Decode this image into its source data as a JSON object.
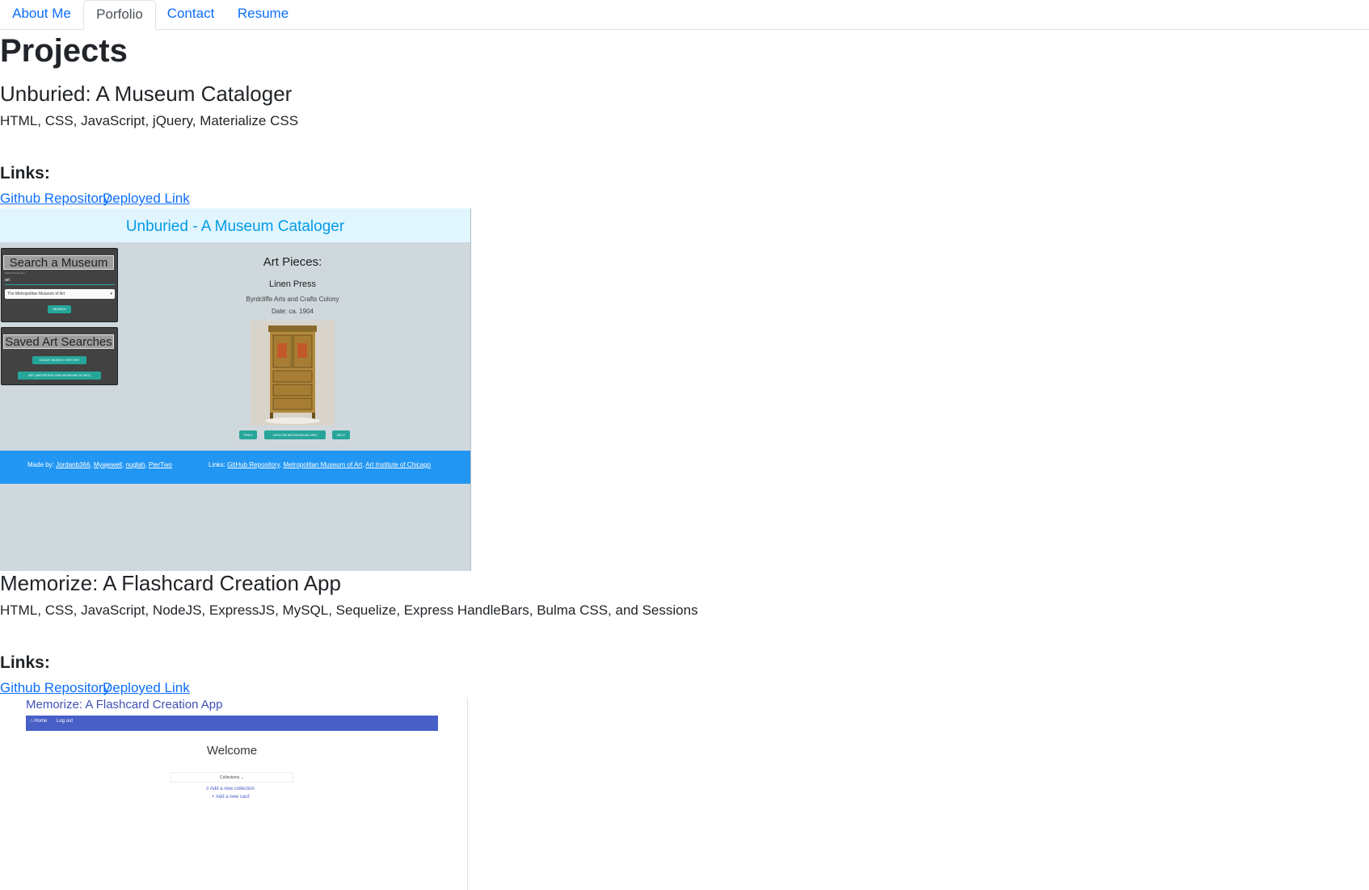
{
  "nav": {
    "tabs": [
      {
        "label": "About Me",
        "active": false
      },
      {
        "label": "Porfolio",
        "active": true
      },
      {
        "label": "Contact",
        "active": false
      },
      {
        "label": "Resume",
        "active": false
      }
    ]
  },
  "page_title": "Projects",
  "projects": [
    {
      "title": "Unburied: A Museum Cataloger",
      "tech": "HTML, CSS, JavaScript, jQuery, Materialize CSS",
      "links_heading": "Links:",
      "github_label": "Github Repository",
      "deployed_label": "Deployed Link",
      "screenshot": {
        "header_title": "Unburied - A Museum Cataloger",
        "search_title": "Search a Museum",
        "search_label": "Search for an item",
        "search_value": "art",
        "museum_select": "The Metropolitan Museum of Art",
        "search_button": "SEARCH",
        "saved_title": "Saved Art Searches",
        "clear_button": "CLEAR SEARCH HISTORY",
        "saved_item": "ART (METROPOLITAN MUSEUM OF ART)",
        "art_heading": "Art Pieces:",
        "art_title": "Linen Press",
        "art_artist": "Byrdcliffe Arts and Crafts Colony",
        "art_date": "Date: ca. 1904",
        "prev_button": "PREV",
        "view_button": "VIEW ON METMUSEUM.ORG",
        "next_button": "NEXT",
        "made_by_label": "Made by:",
        "authors": [
          "Jordanb366",
          "Myajewell",
          "nuglah",
          "PierTwo"
        ],
        "links_label": "Links:",
        "footer_links": [
          "GitHub Repository",
          "Metropolitan Museum of Art",
          "Art Institute of Chicago"
        ]
      }
    },
    {
      "title": "Memorize: A Flashcard Creation App",
      "tech": "HTML, CSS, JavaScript, NodeJS, ExpressJS, MySQL, Sequelize, Express HandleBars, Bulma CSS, and Sessions",
      "links_heading": "Links:",
      "github_label": "Github Repository",
      "deployed_label": "Deployed Link",
      "screenshot": {
        "app_title": "Memorize: A Flashcard Creation App",
        "nav_home": "Home",
        "nav_logout": "Log out",
        "welcome": "Welcome",
        "collections_dropdown": "Collections",
        "add_collection": "Add a new collection",
        "add_card": "Add a new card"
      }
    }
  ],
  "colors": {
    "link": "#0d6efd",
    "materialize_teal": "#26a69a",
    "footer_blue": "#2196f3",
    "bulma_blue": "#485fc7"
  }
}
